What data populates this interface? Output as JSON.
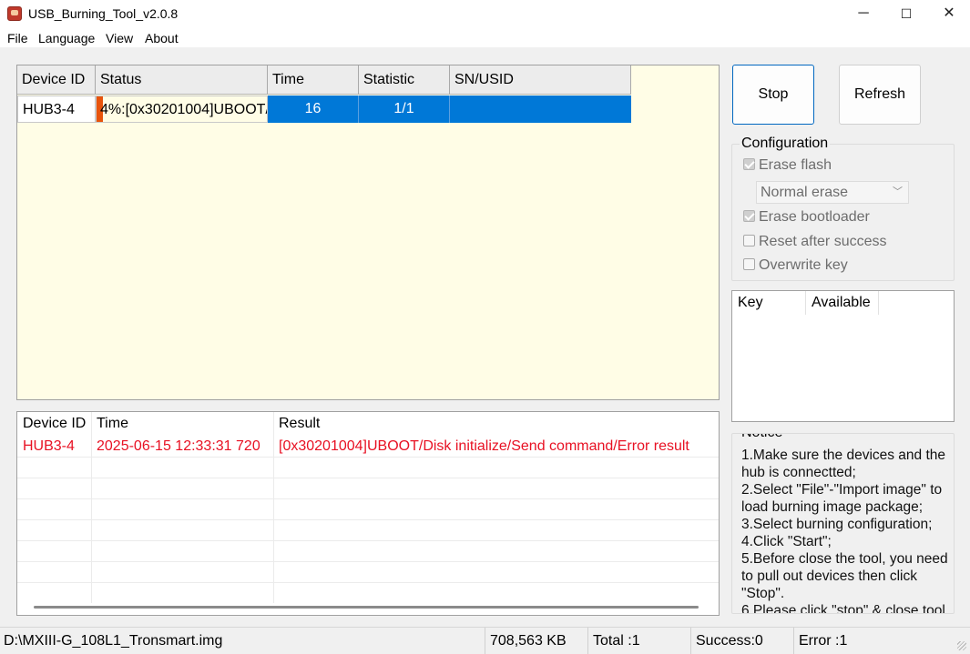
{
  "window": {
    "title": "USB_Burning_Tool_v2.0.8",
    "minimize": "─",
    "maximize": "☐",
    "close": "✕"
  },
  "menu": [
    "File",
    "Language",
    "View",
    "About"
  ],
  "devices": {
    "headers": [
      "Device ID",
      "Status",
      "Time",
      "Statistic",
      "SN/USID"
    ],
    "rows": [
      {
        "device_id": "HUB3-4",
        "status": "4%:[0x30201004]UBOOT/",
        "progress_percent": 4,
        "time": "16",
        "statistic": "1/1",
        "sn": ""
      }
    ]
  },
  "log": {
    "headers": [
      "Device ID",
      "Time",
      "Result"
    ],
    "rows": [
      {
        "device_id": "HUB3-4",
        "time": "2025-06-15 12:33:31 720",
        "result": "[0x30201004]UBOOT/Disk initialize/Send command/Error result"
      }
    ]
  },
  "buttons": {
    "stop": "Stop",
    "refresh": "Refresh"
  },
  "configuration": {
    "title": "Configuration",
    "erase_flash": {
      "label": "Erase flash",
      "checked": true
    },
    "erase_mode": "Normal erase",
    "erase_bootloader": {
      "label": "Erase bootloader",
      "checked": true
    },
    "reset_after_success": {
      "label": "Reset after success",
      "checked": false
    },
    "overwrite_key": {
      "label": "Overwrite key",
      "checked": false
    }
  },
  "keys": {
    "headers": [
      "Key",
      "Available"
    ]
  },
  "notice": {
    "title": "Notice",
    "lines": [
      "1.Make sure the devices and the hub is connectted;",
      "2.Select \"File\"-\"Import image\" to load burning image package;",
      "3.Select burning configuration;",
      "4.Click \"Start\";",
      "5.Before close the tool, you need to pull out devices then click \"Stop\".",
      "6.Please click \"stop\" & close tool"
    ]
  },
  "statusbar": {
    "image_path": "D:\\MXIII-G_108L1_Tronsmart.img",
    "size": "708,563 KB",
    "total": "Total :1",
    "success": "Success:0",
    "error": "Error :1"
  },
  "colors": {
    "accent": "#0078d7",
    "error_text": "#e81123",
    "progress": "#e8540c",
    "table_bg": "#fffde6"
  }
}
